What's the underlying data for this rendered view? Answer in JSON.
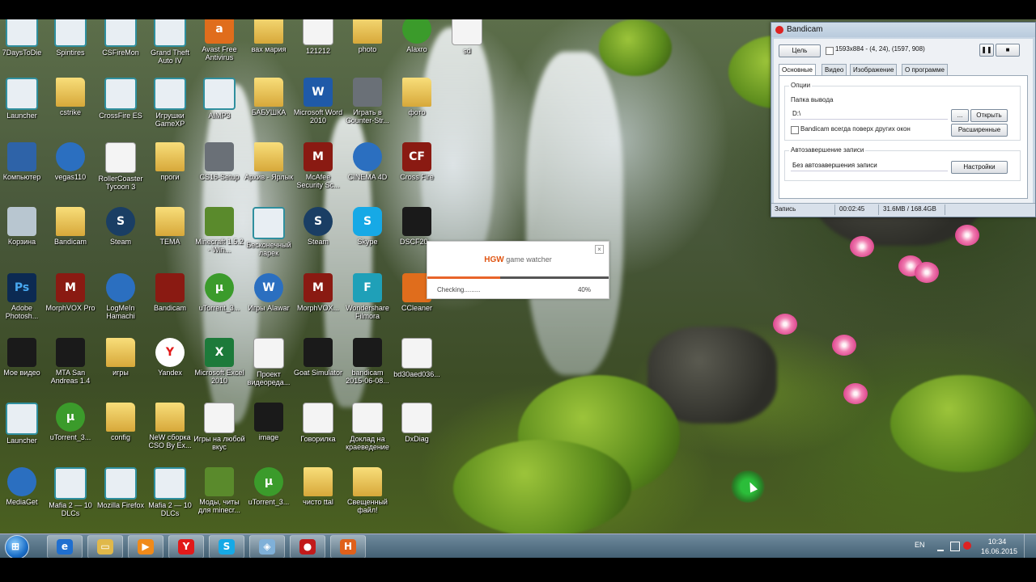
{
  "desktop_icons": [
    {
      "label": "7DaysToDie",
      "glyph": "",
      "style": "ic-app",
      "icon": "app-shortcut-icon"
    },
    {
      "label": "Spintires",
      "glyph": "",
      "style": "ic-app",
      "icon": "app-shortcut-icon"
    },
    {
      "label": "CSFireMon",
      "glyph": "",
      "style": "ic-app",
      "icon": "app-shortcut-icon"
    },
    {
      "label": "Grand Theft Auto IV",
      "glyph": "",
      "style": "ic-app",
      "icon": "app-shortcut-icon"
    },
    {
      "label": "Avast Free Antivirus",
      "glyph": "a",
      "style": "ic-orange",
      "icon": "avast-icon"
    },
    {
      "label": "вах мария",
      "glyph": "",
      "style": "ic-folder",
      "icon": "folder-icon"
    },
    {
      "label": "121212",
      "glyph": "",
      "style": "ic-doc",
      "icon": "document-icon"
    },
    {
      "label": "photo",
      "glyph": "",
      "style": "ic-folder",
      "icon": "folder-icon"
    },
    {
      "label": "Alaxro",
      "glyph": "",
      "style": "ic-utorrent",
      "icon": "app-icon"
    },
    {
      "label": "sd",
      "glyph": "",
      "style": "ic-doc",
      "icon": "document-icon"
    },
    {
      "label": "Launcher",
      "glyph": "",
      "style": "ic-app",
      "icon": "app-shortcut-icon"
    },
    {
      "label": "cstrike",
      "glyph": "",
      "style": "ic-folder",
      "icon": "folder-icon"
    },
    {
      "label": "CrossFire ES",
      "glyph": "",
      "style": "ic-app",
      "icon": "app-shortcut-icon"
    },
    {
      "label": "Игрушки GameXP",
      "glyph": "",
      "style": "ic-app",
      "icon": "app-shortcut-icon"
    },
    {
      "label": "AIMP3",
      "glyph": "",
      "style": "ic-app",
      "icon": "app-shortcut-icon"
    },
    {
      "label": "БАБУШКА",
      "glyph": "",
      "style": "ic-folder",
      "icon": "folder-icon"
    },
    {
      "label": "Microsoft Word 2010",
      "glyph": "W",
      "style": "ic-word",
      "icon": "word-icon"
    },
    {
      "label": "Играть в Counter-Str...",
      "glyph": "",
      "style": "ic-grey",
      "icon": "counter-strike-icon"
    },
    {
      "label": "фото",
      "glyph": "",
      "style": "ic-folder",
      "icon": "folder-icon"
    },
    {
      "label": "Компьютер",
      "glyph": "",
      "style": "ic-monitor",
      "icon": "computer-icon"
    },
    {
      "label": "vegas110",
      "glyph": "",
      "style": "ic-blue",
      "icon": "vegas-icon"
    },
    {
      "label": "RollerCoaster Tycoon 3",
      "glyph": "",
      "style": "ic-doc",
      "icon": "panda-icon"
    },
    {
      "label": "проги",
      "glyph": "",
      "style": "ic-folder",
      "icon": "folder-icon"
    },
    {
      "label": "CS16-Setup",
      "glyph": "",
      "style": "ic-grey",
      "icon": "counter-strike-icon"
    },
    {
      "label": "Архив - Ярлык",
      "glyph": "",
      "style": "ic-folder",
      "icon": "folder-icon"
    },
    {
      "label": "McAfee Security Sc...",
      "glyph": "M",
      "style": "ic-red",
      "icon": "mcafee-icon"
    },
    {
      "label": "CINEMA 4D",
      "glyph": "",
      "style": "ic-blue",
      "icon": "cinema4d-icon"
    },
    {
      "label": "Cross Fire",
      "glyph": "CF",
      "style": "ic-red",
      "icon": "crossfire-icon"
    },
    {
      "label": "Корзина",
      "glyph": "",
      "style": "ic-recycle",
      "icon": "recycle-bin-icon"
    },
    {
      "label": "Bandicam",
      "glyph": "",
      "style": "ic-folder",
      "icon": "folder-icon"
    },
    {
      "label": "Steam",
      "glyph": "S",
      "style": "ic-steam",
      "icon": "steam-icon"
    },
    {
      "label": "ТЕМА",
      "glyph": "",
      "style": "ic-folder",
      "icon": "folder-icon"
    },
    {
      "label": "Minecraft 1.5.2 - Win...",
      "glyph": "",
      "style": "ic-mc",
      "icon": "minecraft-icon"
    },
    {
      "label": "Бесконечный ларек",
      "glyph": "",
      "style": "ic-app",
      "icon": "app-shortcut-icon"
    },
    {
      "label": "Steam",
      "glyph": "S",
      "style": "ic-steam",
      "icon": "steam-icon"
    },
    {
      "label": "Skype",
      "glyph": "S",
      "style": "ic-skype",
      "icon": "skype-icon"
    },
    {
      "label": "DSCF20...",
      "glyph": "",
      "style": "ic-black",
      "icon": "camera-icon"
    },
    {
      "label": "Adobe Photosh...",
      "glyph": "Ps",
      "style": "ic-ps",
      "icon": "photoshop-icon"
    },
    {
      "label": "MorphVOX Pro",
      "glyph": "M",
      "style": "ic-red",
      "icon": "morphvox-icon"
    },
    {
      "label": "LogMeIn Hamachi",
      "glyph": "",
      "style": "ic-blue",
      "icon": "hamachi-icon"
    },
    {
      "label": "Bandicam",
      "glyph": "",
      "style": "ic-red",
      "icon": "bandicam-icon"
    },
    {
      "label": "uTorrent_3...",
      "glyph": "μ",
      "style": "ic-utorrent",
      "icon": "utorrent-icon"
    },
    {
      "label": "Игры Alawar",
      "glyph": "W",
      "style": "ic-blue",
      "icon": "alawar-icon"
    },
    {
      "label": "MorphVOX...",
      "glyph": "M",
      "style": "ic-red",
      "icon": "morphvox-icon"
    },
    {
      "label": "Wondershare Filmora",
      "glyph": "F",
      "style": "ic-cyan",
      "icon": "filmora-icon"
    },
    {
      "label": "CCleaner",
      "glyph": "",
      "style": "ic-orange",
      "icon": "ccleaner-icon"
    },
    {
      "label": "Мое видео",
      "glyph": "",
      "style": "ic-black",
      "icon": "video-icon"
    },
    {
      "label": "MTA San Andreas 1.4",
      "glyph": "",
      "style": "ic-black",
      "icon": "mta-icon"
    },
    {
      "label": "игры",
      "glyph": "",
      "style": "ic-folder",
      "icon": "folder-icon"
    },
    {
      "label": "Yandex",
      "glyph": "Y",
      "style": "ic-yandex",
      "icon": "yandex-icon"
    },
    {
      "label": "Microsoft Excel 2010",
      "glyph": "X",
      "style": "ic-excel",
      "icon": "excel-icon"
    },
    {
      "label": "Проект видеореда...",
      "glyph": "",
      "style": "ic-doc",
      "icon": "project-icon"
    },
    {
      "label": "Goat Simulator",
      "glyph": "",
      "style": "ic-black",
      "icon": "goat-icon"
    },
    {
      "label": "bandicam 2015-06-08...",
      "glyph": "",
      "style": "ic-black",
      "icon": "video-file-icon"
    },
    {
      "label": "bd30aed036...",
      "glyph": "",
      "style": "ic-doc",
      "icon": "mp3-icon"
    },
    {
      "label": "Launcher",
      "glyph": "",
      "style": "ic-app",
      "icon": "app-shortcut-icon"
    },
    {
      "label": "uTorrent_3...",
      "glyph": "μ",
      "style": "ic-utorrent",
      "icon": "utorrent-icon"
    },
    {
      "label": "config",
      "glyph": "",
      "style": "ic-folder",
      "icon": "folder-icon"
    },
    {
      "label": "NeW сборка CSO By Ex...",
      "glyph": "",
      "style": "ic-folder",
      "icon": "folder-icon"
    },
    {
      "label": "Игры на любой вкус",
      "glyph": "",
      "style": "ic-doc",
      "icon": "document-icon"
    },
    {
      "label": "image",
      "glyph": "",
      "style": "ic-black",
      "icon": "image-icon"
    },
    {
      "label": "Говорилка",
      "glyph": "",
      "style": "ic-doc",
      "icon": "app-icon"
    },
    {
      "label": "Доклад на краеведение",
      "glyph": "",
      "style": "ic-doc",
      "icon": "document-icon"
    },
    {
      "label": "DxDiag",
      "glyph": "",
      "style": "ic-doc",
      "icon": "document-icon"
    },
    {
      "label": "MediaGet",
      "glyph": "",
      "style": "ic-blue",
      "icon": "mediaget-icon"
    },
    {
      "label": "Mafia 2 — 10 DLCs",
      "glyph": "",
      "style": "ic-app",
      "icon": "app-shortcut-icon"
    },
    {
      "label": "Mozilla Firefox",
      "glyph": "",
      "style": "ic-app",
      "icon": "app-shortcut-icon"
    },
    {
      "label": "Mafia 2 — 10 DLCs",
      "glyph": "",
      "style": "ic-app",
      "icon": "app-shortcut-icon"
    },
    {
      "label": "Моды, читы для minecr...",
      "glyph": "",
      "style": "ic-mc",
      "icon": "minecraft-icon"
    },
    {
      "label": "uTorrent_3...",
      "glyph": "μ",
      "style": "ic-utorrent",
      "icon": "utorrent-icon"
    },
    {
      "label": "чисто ttal",
      "glyph": "",
      "style": "ic-folder",
      "icon": "folder-icon"
    },
    {
      "label": "Свещенный файл!",
      "glyph": "",
      "style": "ic-folder",
      "icon": "folder-icon"
    }
  ],
  "hgw": {
    "brand": "HGW",
    "title": "game watcher",
    "close": "×",
    "status": "Checking.........",
    "percent_label": "40%",
    "progress": 0.4
  },
  "bandicam": {
    "title": "Bandicam",
    "target_button": "Цель",
    "region_text": "1593x884 - (4, 24), (1597, 908)",
    "pause_glyph": "❚❚",
    "stop_glyph": "■",
    "tabs": [
      "Основные",
      "Видео",
      "Изображение",
      "О программе"
    ],
    "options_header": "Опции",
    "output_folder_label": "Папка вывода",
    "output_folder_value": "D:\\",
    "browse_button": "...",
    "open_button": "Открыть",
    "always_on_top_label": "Bandicam всегда поверх других окон",
    "advanced_button": "Расширенные",
    "autocomplete_header": "Автозавершение записи",
    "autocomplete_value": "Без автозавершения записи",
    "settings_button": "Настройки",
    "status_recording": "Запись",
    "status_time": "00:02:45",
    "status_size": "31.6MB / 168.4GB"
  },
  "taskbar": {
    "start_glyph": "⊞",
    "pinned": [
      {
        "name": "internet-explorer",
        "glyph": "e",
        "color": "#1f6fd0"
      },
      {
        "name": "explorer",
        "glyph": "▭",
        "color": "#e0b84a"
      },
      {
        "name": "media-player",
        "glyph": "▶",
        "color": "#f08a1a"
      },
      {
        "name": "yandex",
        "glyph": "Y",
        "color": "#e21a1a"
      },
      {
        "name": "skype",
        "glyph": "S",
        "color": "#16a9e6"
      },
      {
        "name": "app",
        "glyph": "◈",
        "color": "#7fb0d8"
      },
      {
        "name": "bandicam",
        "glyph": "●",
        "color": "#c21a1a"
      },
      {
        "name": "hgw",
        "glyph": "H",
        "color": "#e0601a"
      }
    ],
    "lang": "EN",
    "time": "10:34",
    "date": "16.06.2015"
  }
}
